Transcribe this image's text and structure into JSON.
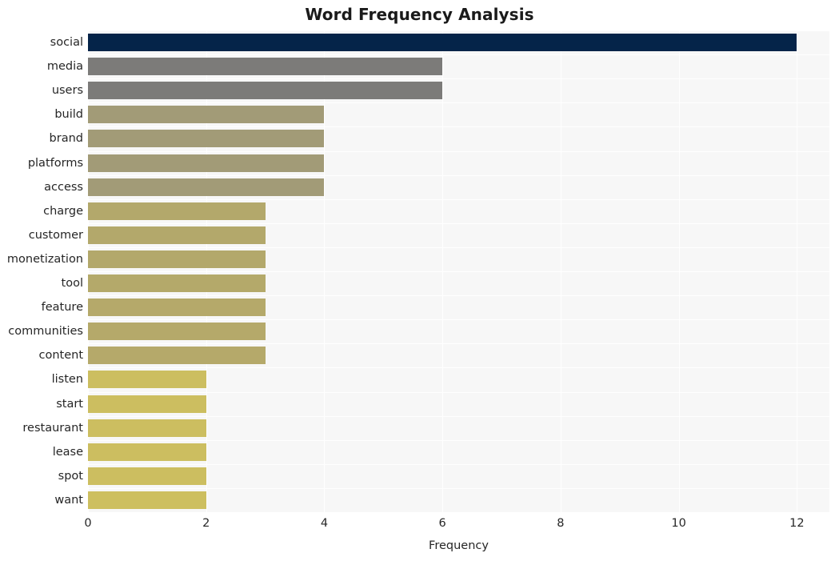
{
  "chart_data": {
    "type": "bar",
    "orientation": "horizontal",
    "title": "Word Frequency Analysis",
    "xlabel": "Frequency",
    "ylabel": "",
    "categories": [
      "social",
      "media",
      "users",
      "build",
      "brand",
      "platforms",
      "access",
      "charge",
      "customer",
      "monetization",
      "tool",
      "feature",
      "communities",
      "content",
      "listen",
      "start",
      "restaurant",
      "lease",
      "spot",
      "want"
    ],
    "values": [
      12,
      6,
      6,
      4,
      4,
      4,
      4,
      3,
      3,
      3,
      3,
      3,
      3,
      3,
      2,
      2,
      2,
      2,
      2,
      2
    ],
    "bar_colors": [
      "#052449",
      "#7c7b79",
      "#7c7b79",
      "#a29b77",
      "#a29b77",
      "#a29b77",
      "#a29b77",
      "#b3a86b",
      "#b3a86b",
      "#b3a86b",
      "#b4a96a",
      "#b5a96a",
      "#b5a96a",
      "#b5a96a",
      "#ccbe60",
      "#ccbe60",
      "#ccbe60",
      "#ccbe60",
      "#ccbe60",
      "#cdbf5f"
    ],
    "xlim": [
      0,
      12.55
    ],
    "xticks": [
      0,
      2,
      4,
      6,
      8,
      10,
      12
    ],
    "xtick_labels": [
      "0",
      "2",
      "4",
      "6",
      "8",
      "10",
      "12"
    ],
    "grid": true,
    "grid_color": "#ffffff",
    "plot_background": "#f7f7f7",
    "figure_background": "#ffffff",
    "legend": null,
    "title_color": "#1a1a1a",
    "tick_color": "#262626"
  }
}
